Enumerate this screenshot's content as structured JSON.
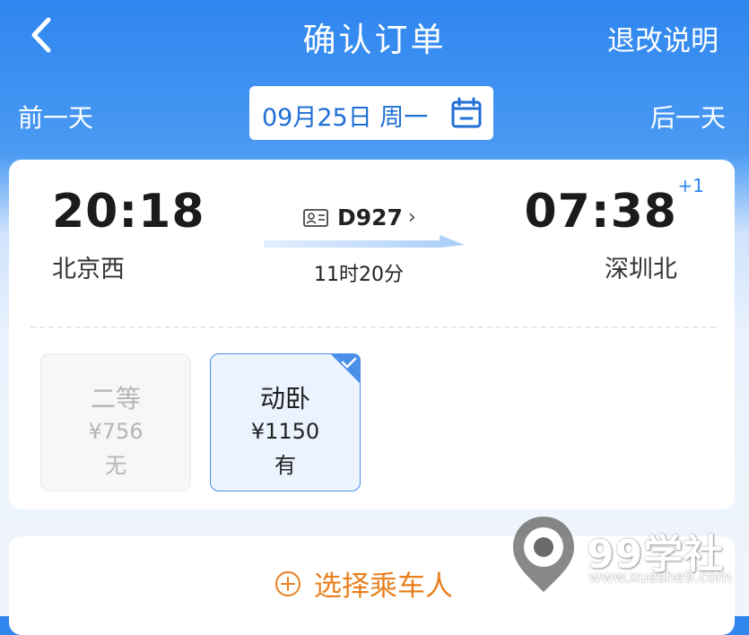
{
  "header": {
    "title": "确认订单",
    "refund_link": "退改说明"
  },
  "date_bar": {
    "prev_day": "前一天",
    "date": "09月25日 周一",
    "next_day": "后一天"
  },
  "train": {
    "departure_time": "20:18",
    "departure_station": "北京西",
    "arrival_time": "07:38",
    "arrival_day_offset": "+1",
    "arrival_station": "深圳北",
    "train_number": "D927",
    "chevron": "›",
    "duration": "11时20分"
  },
  "seats": [
    {
      "name": "二等",
      "price": "¥756",
      "availability": "无",
      "selected": false
    },
    {
      "name": "动卧",
      "price": "¥1150",
      "availability": "有",
      "selected": true
    }
  ],
  "passenger": {
    "add_label": "选择乘车人"
  },
  "watermark": {
    "brand": "99学社",
    "url": "www.xueshe9.com"
  },
  "colors": {
    "primary_blue": "#2f86ef",
    "accent_orange": "#e8801f",
    "selected_border": "#4a8fe8"
  },
  "icons": {
    "back": "chevron-left-icon",
    "calendar": "calendar-icon",
    "train_id": "id-card-icon",
    "check": "check-icon",
    "add": "plus-circle-icon"
  }
}
